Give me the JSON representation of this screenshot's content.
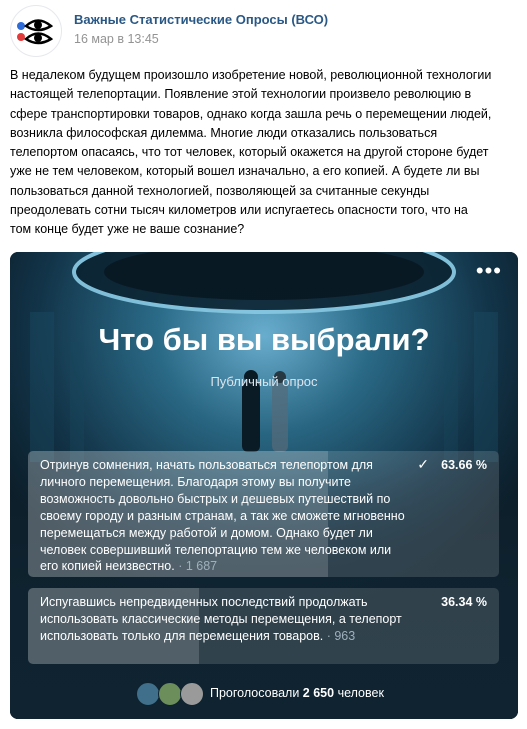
{
  "header": {
    "group_name": "Важные Статистические Опросы (ВСО)",
    "date": "16 мар в 13:45",
    "platform_icon": "apple-icon"
  },
  "post": {
    "text": "В недалеком будущем произошло изобретение новой, революционной технологии\nнастоящей телепортации. Появление этой технологии произвело революцию в\nсфере транспортировки товаров, однако когда зашла речь о перемещении людей,\nвозникла философская дилемма. Многие люди отказались пользоваться\nтелепортом опасаясь, что тот человек, который окажется на другой стороне будет\nуже не тем человеком, который вошел изначально, а его копией. А будете ли вы\nпользоваться данной технологией, позволяющей за считанные секунды\nпреодолевать сотни тысяч километров или испугаетесь опасности того, что на\nтом конце будет уже не ваше сознание?"
  },
  "poll": {
    "menu_icon": "more-dots-icon",
    "title": "Что бы вы выбрали?",
    "type": "Публичный опрос",
    "options": [
      {
        "text": "Отринув сомнения, начать пользоваться телепортом для личного перемещения. Благодаря этому вы получите возможность довольно быстрых и дешевых путешествий по своему городу и разным странам, а так же сможете мгновенно перемещаться между работой и домом. Однако будет ли человек совершивший телепортацию тем же человеком или его копией неизвестно.",
        "count": " · 1 687",
        "percent": "63.66 %",
        "fraction": 0.6366,
        "selected": true
      },
      {
        "text": "Испугавшись непредвиденных последствий продолжать использовать классические методы перемещения, а телепорт использовать только для перемещения товаров.",
        "count": " · 963",
        "percent": "36.34 %",
        "fraction": 0.3634,
        "selected": false
      }
    ],
    "voters": {
      "label": "Проголосовали",
      "count": "2 650",
      "suffix": "человек"
    }
  },
  "colors": {
    "link": "#2a5885",
    "poll_bg": "#0f2330"
  }
}
